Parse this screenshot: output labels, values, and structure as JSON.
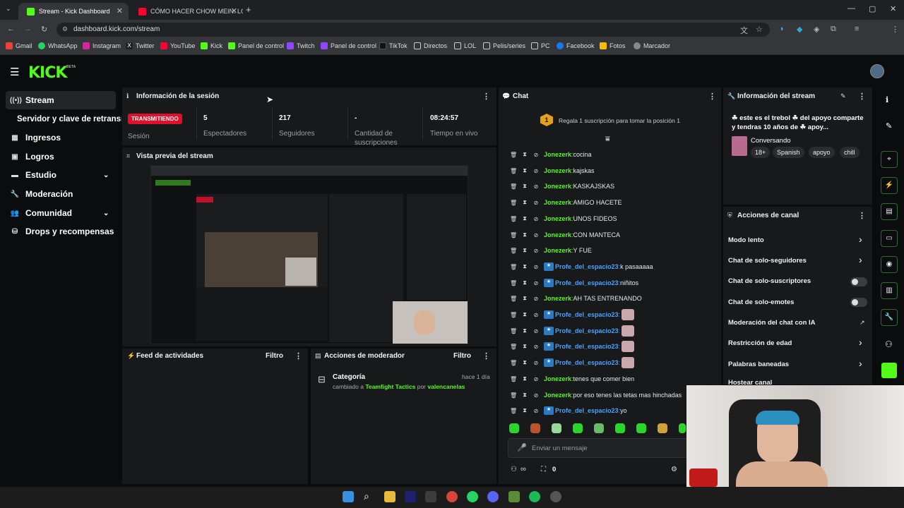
{
  "browser": {
    "tabs": [
      {
        "title": "Stream - Kick Dashboard",
        "active": true
      },
      {
        "title": "CÓMO HACER CHOW MEIN: LO",
        "active": false
      }
    ],
    "url": "dashboard.kick.com/stream",
    "bookmarks": [
      "Gmail",
      "WhatsApp",
      "Instagram",
      "Twitter",
      "YouTube",
      "Kick",
      "Panel de control",
      "Twitch",
      "Panel de control",
      "TikTok",
      "Directos",
      "LOL",
      "Pelis/series",
      "PC",
      "Facebook",
      "Fotos",
      "Marcador"
    ]
  },
  "app": {
    "logo": "KICK",
    "beta": "BETA"
  },
  "sidebar": {
    "items": [
      {
        "label": "Stream",
        "icon": "broadcast-icon"
      },
      {
        "label": "Servidor y clave de retransm",
        "icon": ""
      },
      {
        "label": "Ingresos",
        "icon": "revenue-icon"
      },
      {
        "label": "Logros",
        "icon": "achievements-icon"
      },
      {
        "label": "Estudio",
        "icon": "studio-icon"
      },
      {
        "label": "Moderación",
        "icon": "wrench-icon"
      },
      {
        "label": "Comunidad",
        "icon": "community-icon"
      },
      {
        "label": "Drops y recompensas",
        "icon": "drops-icon"
      }
    ]
  },
  "session": {
    "title": "Información de la sesión",
    "status_badge": "TRANSMITIENDO",
    "stats": [
      {
        "value": "",
        "label": "Sesión"
      },
      {
        "value": "5",
        "label": "Espectadores"
      },
      {
        "value": "217",
        "label": "Seguidores"
      },
      {
        "value": "-",
        "label": "Cantidad de suscripciones"
      },
      {
        "value": "08:24:57",
        "label": "Tiempo en vivo"
      }
    ]
  },
  "preview": {
    "title": "Vista previa del stream"
  },
  "activity": {
    "title": "Feed de actividades",
    "filter": "Filtro"
  },
  "modactions": {
    "title": "Acciones de moderador",
    "filter": "Filtro",
    "entry": {
      "title": "Categoría",
      "time": "hace 1 día",
      "prefix": "cambiado a",
      "game": "Teamfight Tactics",
      "by": "por",
      "user": "valencanelas"
    }
  },
  "chat": {
    "title": "Chat",
    "gift_rank": "1",
    "gift_text": "Regala 1 suscripción para tomar la posición 1",
    "messages": [
      {
        "user": "Jonezerk",
        "text": "cocina",
        "type": "k"
      },
      {
        "user": "Jonezerk",
        "text": "kajskas",
        "type": "k"
      },
      {
        "user": "Jonezerk",
        "text": "KASKAJSKAS",
        "type": "k"
      },
      {
        "user": "Jonezerk",
        "text": "AMIGO HACETE",
        "type": "k"
      },
      {
        "user": "Jonezerk",
        "text": "UNOS FIDEOS",
        "type": "k"
      },
      {
        "user": "Jonezerk",
        "text": "CON MANTECA",
        "type": "k"
      },
      {
        "user": "Jonezerk",
        "text": "Y FUE",
        "type": "k"
      },
      {
        "user": "Profe_del_espacio23",
        "text": "k pasaaaaa",
        "type": "p"
      },
      {
        "user": "Profe_del_espacio23",
        "text": "niñitos",
        "type": "p"
      },
      {
        "user": "Jonezerk",
        "text": "AH TAS ENTRENANDO",
        "type": "k"
      },
      {
        "user": "Profe_del_espacio23",
        "text": "",
        "type": "p",
        "emote": true
      },
      {
        "user": "Profe_del_espacio23",
        "text": "",
        "type": "p",
        "emote": true
      },
      {
        "user": "Profe_del_espacio23",
        "text": "",
        "type": "p",
        "emote": true
      },
      {
        "user": "Profe_del_espacio23",
        "text": "",
        "type": "p",
        "emote": true
      },
      {
        "user": "Jonezerk",
        "text": "tenes que comer bien",
        "type": "k"
      },
      {
        "user": "Jonezerk",
        "text": "por eso tenes las tetas mas hinchadas",
        "type": "k"
      },
      {
        "user": "Profe_del_espacio23",
        "text": "yo",
        "type": "p"
      }
    ],
    "input_placeholder": "Enviar un mensaje",
    "infinity": "∞",
    "points": "0"
  },
  "stream_info": {
    "title": "Información del stream",
    "stream_title": "☘ este es el trebol ☘ del apoyo comparte y tendras 10 años de ☘ apoy...",
    "category": "Conversando",
    "tags": [
      "18+",
      "Spanish",
      "apoyo",
      "chill"
    ]
  },
  "channel_actions": {
    "title": "Acciones de canal",
    "items": [
      {
        "label": "Modo lento",
        "control": "arrow"
      },
      {
        "label": "Chat de solo-seguidores",
        "control": "arrow"
      },
      {
        "label": "Chat de solo-suscriptores",
        "control": "toggle"
      },
      {
        "label": "Chat de solo-emotes",
        "control": "toggle"
      },
      {
        "label": "Moderación del chat con IA",
        "control": "external"
      },
      {
        "label": "Restricción de edad",
        "control": "arrow"
      },
      {
        "label": "Palabras baneadas",
        "control": "arrow"
      },
      {
        "label": "Hostear canal",
        "control": "none"
      }
    ]
  },
  "colors": {
    "accent": "#53fc18",
    "live": "#e0102a",
    "panel": "#18191b",
    "bg": "#0b0c0d"
  }
}
